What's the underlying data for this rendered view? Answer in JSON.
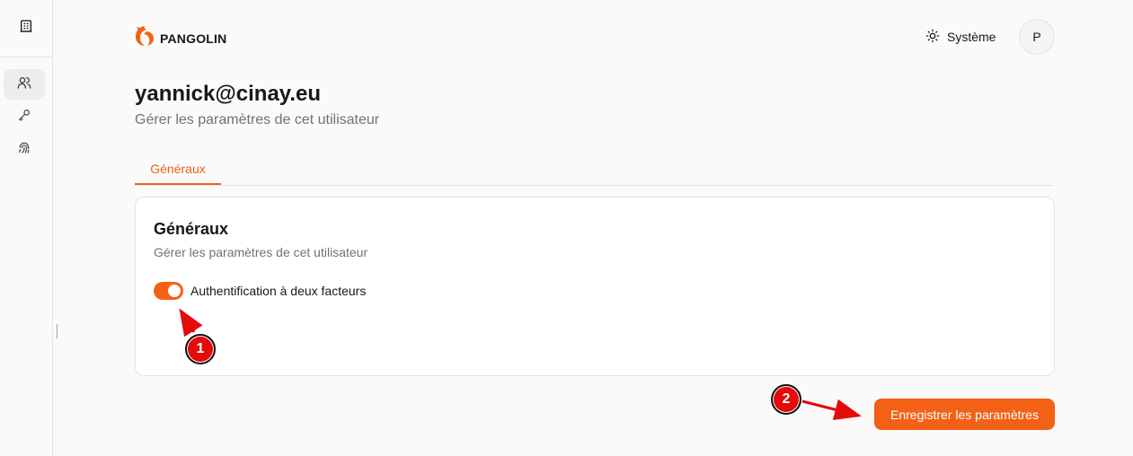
{
  "app": {
    "name": "PANGOLIN"
  },
  "header": {
    "theme_label": "Système",
    "avatar_initial": "P"
  },
  "sidebar": {
    "items": [
      {
        "icon": "building-icon"
      },
      {
        "icon": "users-icon",
        "active": true
      },
      {
        "icon": "key-icon"
      },
      {
        "icon": "fingerprint-icon"
      }
    ]
  },
  "page": {
    "title": "yannick@cinay.eu",
    "subtitle": "Gérer les paramètres de cet utilisateur"
  },
  "tabs": [
    {
      "label": "Généraux",
      "active": true
    }
  ],
  "card": {
    "title": "Généraux",
    "subtitle": "Gérer les paramètres de cet utilisateur",
    "two_factor": {
      "label": "Authentification à deux facteurs",
      "enabled": true
    }
  },
  "actions": {
    "save_label": "Enregistrer les paramètres"
  },
  "annotations": [
    {
      "number": "1"
    },
    {
      "number": "2"
    }
  ],
  "colors": {
    "accent": "#f36117",
    "annotation": "#e30b0b"
  }
}
